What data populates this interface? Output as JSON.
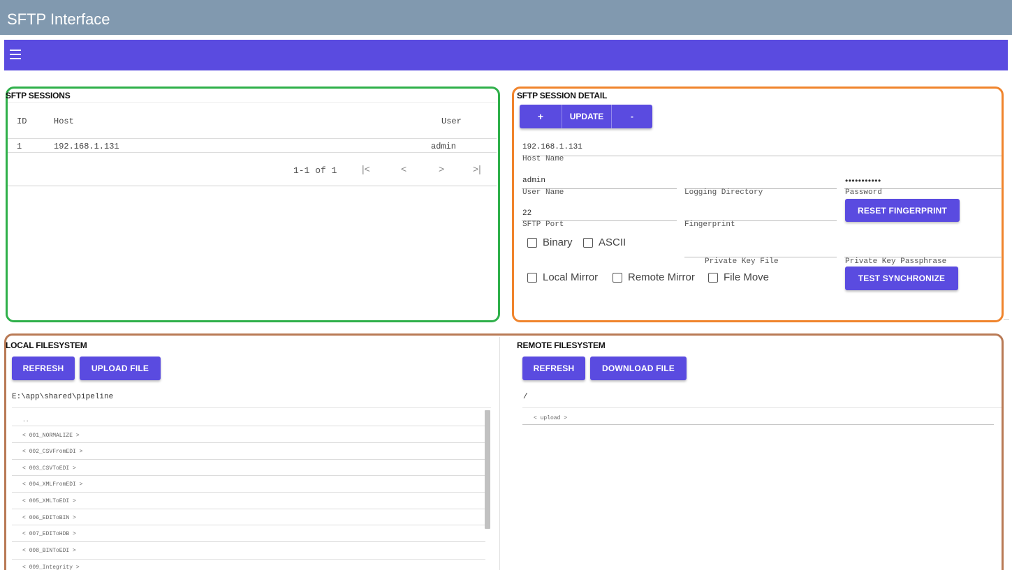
{
  "window": {
    "title": "SFTP Interface"
  },
  "appbar": {
    "menu_icon": "hamburger-menu-icon"
  },
  "sessions": {
    "title": "SFTP SESSIONS",
    "columns": [
      "ID",
      "Host",
      "User"
    ],
    "rows": [
      {
        "id": "1",
        "host": "192.168.1.131",
        "user": "admin"
      }
    ],
    "pagination": {
      "range": "1-1 of 1",
      "first": "|<",
      "prev": "<",
      "next": ">",
      "last": ">|"
    }
  },
  "detail": {
    "title": "SFTP SESSION DETAIL",
    "buttons": {
      "add": "+",
      "update": "UPDATE",
      "remove": "-"
    },
    "host": {
      "value": "192.168.1.131",
      "label": "Host Name"
    },
    "user": {
      "value": "admin",
      "label": "User Name"
    },
    "logging": {
      "value": "",
      "label": "Logging Directory"
    },
    "password": {
      "value": "•••••••••••",
      "label": "Password"
    },
    "reset_fingerprint": "RESET FINGERPRINT",
    "port": {
      "value": "22",
      "label": "SFTP Port"
    },
    "fingerprint": {
      "value": "",
      "label": "Fingerprint"
    },
    "checkboxes": {
      "binary": "Binary",
      "ascii": "ASCII",
      "local_mirror": "Local Mirror",
      "remote_mirror": "Remote Mirror",
      "file_move": "File Move"
    },
    "private_key_file": {
      "label": "Private Key File"
    },
    "private_key_passphrase": {
      "label": "Private Key Passphrase"
    },
    "test_synchronize": "TEST SYNCHRONIZE"
  },
  "local_fs": {
    "title": "LOCAL FILESYSTEM",
    "refresh": "REFRESH",
    "upload": "UPLOAD FILE",
    "path": "E:\\app\\shared\\pipeline",
    "items": [
      "..",
      "< 001_NORMALIZE >",
      "< 002_CSVFromEDI >",
      "< 003_CSVToEDI >",
      "< 004_XMLFromEDI >",
      "< 005_XMLToEDI >",
      "< 006_EDIToBIN >",
      "< 007_EDIToHDB >",
      "< 008_BINToEDI >",
      "< 009_Integrity >"
    ]
  },
  "remote_fs": {
    "title": "REMOTE FILESYSTEM",
    "refresh": "REFRESH",
    "download": "DOWNLOAD FILE",
    "path": "/",
    "items": [
      "< upload >"
    ]
  }
}
